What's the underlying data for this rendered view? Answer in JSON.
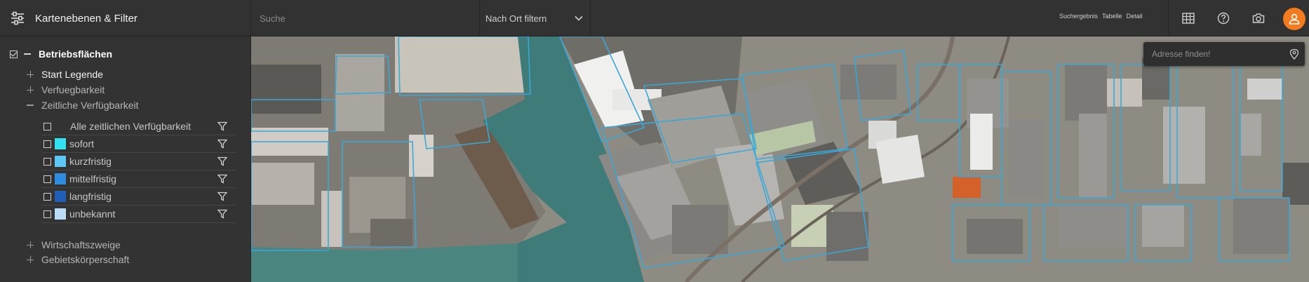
{
  "header": {
    "panel_title": "Kartenebenen & Filter",
    "search_placeholder": "Suche",
    "ort_filter_label": "Nach Ort filtern",
    "view_tabs": [
      "Suchergebnis",
      "Tabelle",
      "Detail"
    ],
    "tool_icons": [
      "table-icon",
      "help-icon",
      "camera-icon",
      "user-icon"
    ],
    "avatar_color": "#f47a20"
  },
  "layers": {
    "group_title": "Betriebsflächen",
    "group_checked": true,
    "sections": {
      "start_legende": "Start Legende",
      "verfuegbarkeit": "Verfuegbarkeit",
      "zeitliche": "Zeitliche Verfügbarkeit"
    },
    "all_label": "Alle zeitlichen Verfügbarkeit",
    "items": [
      {
        "label": "sofort",
        "color": "#33e0f0"
      },
      {
        "label": "kurzfristig",
        "color": "#5bc8f5"
      },
      {
        "label": "mittelfristig",
        "color": "#2f8de0"
      },
      {
        "label": "langfristig",
        "color": "#1f5fb8"
      },
      {
        "label": "unbekannt",
        "color": "#b8dcf5"
      }
    ],
    "more_sections": {
      "wirtschaftszweige": "Wirtschaftszweige",
      "gebietskoerperschaft": "Gebietskörperschaft"
    }
  },
  "map": {
    "address_placeholder": "Adresse finden!"
  }
}
